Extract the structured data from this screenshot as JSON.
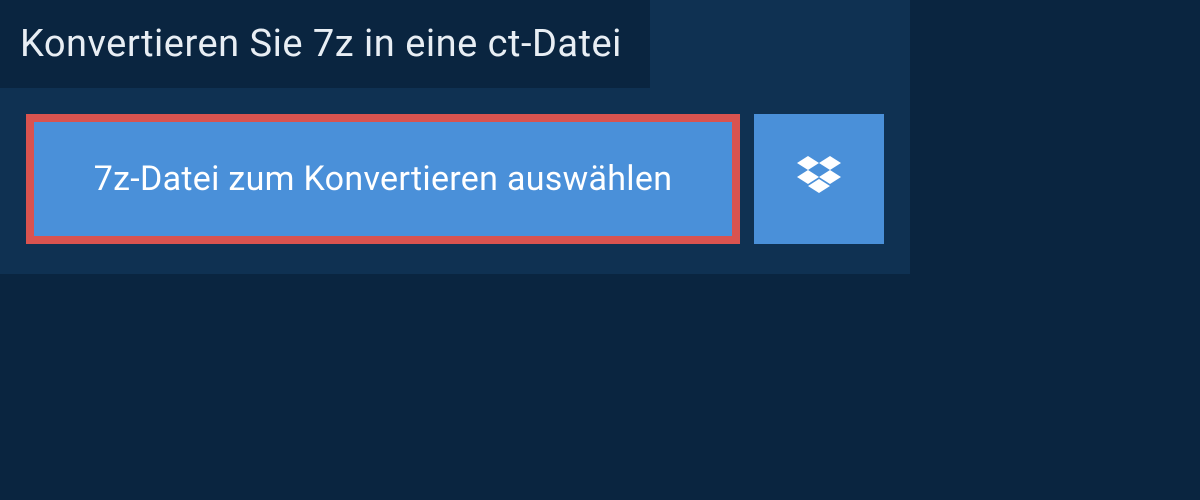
{
  "header": {
    "title": "Konvertieren Sie 7z in eine ct-Datei"
  },
  "actions": {
    "select_file_label": "7z-Datei zum Konvertieren auswählen",
    "dropbox_icon_name": "dropbox-icon"
  },
  "colors": {
    "page_bg": "#0a2540",
    "panel_bg": "#0f3152",
    "button_bg": "#4a90d9",
    "highlight_border": "#d9534f",
    "text_light": "#e8eef4",
    "text_white": "#ffffff"
  }
}
